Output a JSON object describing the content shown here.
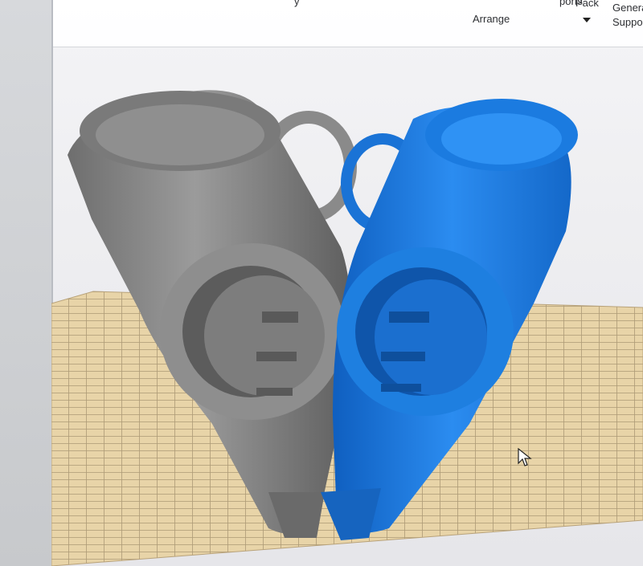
{
  "toolbar": {
    "partial_left": "y",
    "partial_top_mid": "ports",
    "pack_label": "Pack",
    "arrange_label": "Arrange",
    "generate_label": "Generat",
    "supports_label": "Support"
  },
  "scene": {
    "grey_part_color": "#8d8d8d",
    "blue_part_color": "#1e7fe0",
    "build_plate_color": "#e9d6ab",
    "grid_line_color": "#a99774"
  },
  "icons": {
    "pack_dropdown": "chevron-down-icon",
    "cursor": "arrow-cursor-icon"
  }
}
